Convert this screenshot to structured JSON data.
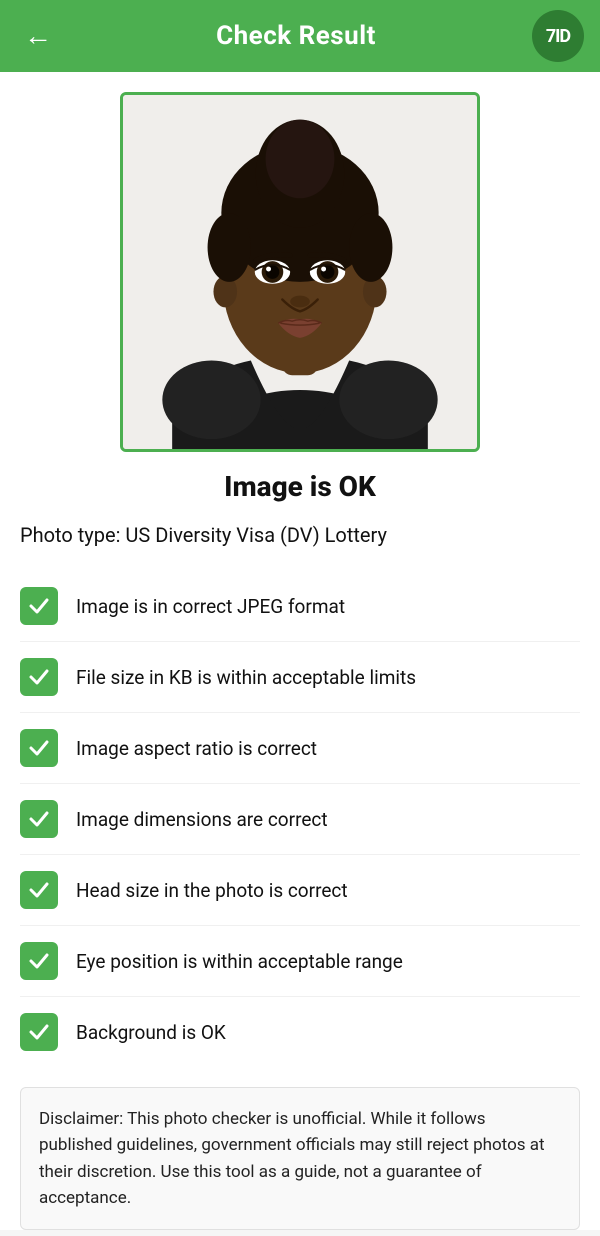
{
  "header": {
    "back_icon": "←",
    "title": "Check Result",
    "logo_text": "7ID"
  },
  "status": {
    "text": "Image is OK"
  },
  "photo_type": {
    "label": "Photo type: US Diversity Visa (DV) Lottery"
  },
  "checks": [
    {
      "label": "Image is in correct JPEG format",
      "passed": true
    },
    {
      "label": "File size in KB is within acceptable limits",
      "passed": true
    },
    {
      "label": "Image aspect ratio is correct",
      "passed": true
    },
    {
      "label": "Image dimensions are correct",
      "passed": true
    },
    {
      "label": "Head size in the photo is correct",
      "passed": true
    },
    {
      "label": "Eye position is within acceptable range",
      "passed": true
    },
    {
      "label": "Background is OK",
      "passed": true
    }
  ],
  "disclaimer": {
    "text": "Disclaimer: This photo checker is unofficial. While it follows published guidelines, government officials may still reject photos at their discretion. Use this tool as a guide, not a guarantee of acceptance."
  },
  "colors": {
    "green": "#4caf50",
    "dark_green": "#2e7d32"
  }
}
